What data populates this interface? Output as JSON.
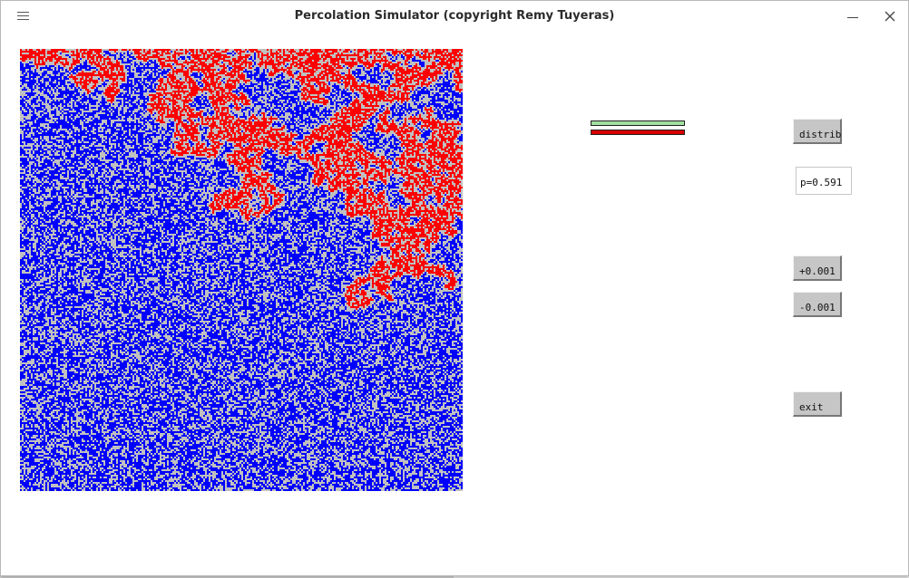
{
  "window": {
    "title": "Percolation Simulator (copyright Remy Tuyeras)"
  },
  "icons": {
    "menu": "hamburger-menu-icon",
    "minimize": "minimize-icon",
    "close": "close-icon"
  },
  "simulation": {
    "probability": 0.591,
    "colors": {
      "open_site": "#0000ff",
      "blocked_site": "#c0c0c0",
      "spanning_cluster": "#ff0000"
    }
  },
  "indicators": {
    "green_bar_color": "#a0e0a0",
    "red_bar_color": "#d80000"
  },
  "controls": {
    "distrib_label": "distrib",
    "p_value": "p=0.591",
    "plus_label": "+0.001",
    "minus_label": "-0.001",
    "exit_label": "exit"
  }
}
